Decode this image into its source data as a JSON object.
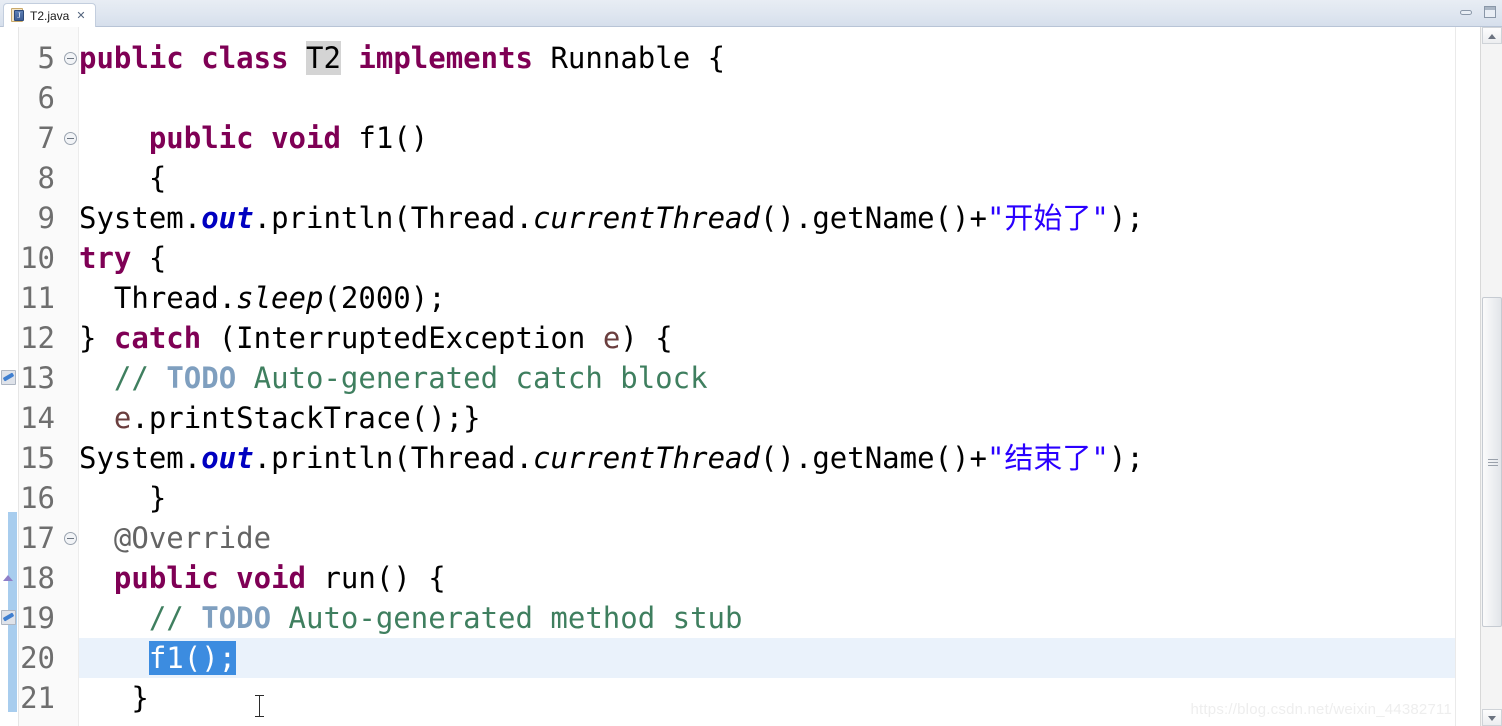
{
  "window": {
    "minimize_label": "Minimize",
    "maximize_label": "Maximize"
  },
  "tab": {
    "label": "T2.java",
    "icon": "java-file-icon",
    "icon_letter": "J",
    "close_glyph": "✕"
  },
  "editor": {
    "first_visible_line": 5,
    "current_line": 20,
    "selection_text": "f1();",
    "occurrence_highlight": "T2",
    "lines": [
      {
        "num": "5",
        "fold": true,
        "tokens": [
          {
            "t": "public",
            "c": "kw"
          },
          {
            "t": " ",
            "c": "plain"
          },
          {
            "t": "class",
            "c": "kw"
          },
          {
            "t": " ",
            "c": "plain"
          },
          {
            "t": "T2",
            "c": "occ"
          },
          {
            "t": " ",
            "c": "plain"
          },
          {
            "t": "implements",
            "c": "kw"
          },
          {
            "t": " Runnable {",
            "c": "plain"
          }
        ]
      },
      {
        "num": "6",
        "tokens": []
      },
      {
        "num": "7",
        "fold": true,
        "tokens": [
          {
            "t": "    ",
            "c": "plain"
          },
          {
            "t": "public",
            "c": "kw"
          },
          {
            "t": " ",
            "c": "plain"
          },
          {
            "t": "void",
            "c": "kw"
          },
          {
            "t": " f1()",
            "c": "plain"
          }
        ]
      },
      {
        "num": "8",
        "tokens": [
          {
            "t": "    {",
            "c": "plain"
          }
        ]
      },
      {
        "num": "9",
        "tokens": [
          {
            "t": "System.",
            "c": "plain"
          },
          {
            "t": "out",
            "c": "sfield"
          },
          {
            "t": ".println(Thread.",
            "c": "plain"
          },
          {
            "t": "currentThread",
            "c": "smeth"
          },
          {
            "t": "().getName()+",
            "c": "plain"
          },
          {
            "t": "\"开始了\"",
            "c": "str"
          },
          {
            "t": ");",
            "c": "plain"
          }
        ]
      },
      {
        "num": "10",
        "tokens": [
          {
            "t": "try",
            "c": "kw"
          },
          {
            "t": " {",
            "c": "plain"
          }
        ]
      },
      {
        "num": "11",
        "tokens": [
          {
            "t": "  Thread.",
            "c": "plain"
          },
          {
            "t": "sleep",
            "c": "smeth"
          },
          {
            "t": "(2000);",
            "c": "plain"
          }
        ]
      },
      {
        "num": "12",
        "tokens": [
          {
            "t": "} ",
            "c": "plain"
          },
          {
            "t": "catch",
            "c": "kw"
          },
          {
            "t": " (InterruptedException ",
            "c": "plain"
          },
          {
            "t": "e",
            "c": "param"
          },
          {
            "t": ") {",
            "c": "plain"
          }
        ]
      },
      {
        "num": "13",
        "marker": "task",
        "tokens": [
          {
            "t": "  // ",
            "c": "cmt"
          },
          {
            "t": "TODO",
            "c": "todo"
          },
          {
            "t": " Auto-generated catch block",
            "c": "cmt"
          }
        ]
      },
      {
        "num": "14",
        "tokens": [
          {
            "t": "  ",
            "c": "plain"
          },
          {
            "t": "e",
            "c": "param"
          },
          {
            "t": ".printStackTrace();}",
            "c": "plain"
          }
        ]
      },
      {
        "num": "15",
        "tokens": [
          {
            "t": "System.",
            "c": "plain"
          },
          {
            "t": "out",
            "c": "sfield"
          },
          {
            "t": ".println(Thread.",
            "c": "plain"
          },
          {
            "t": "currentThread",
            "c": "smeth"
          },
          {
            "t": "().getName()+",
            "c": "plain"
          },
          {
            "t": "\"结束了\"",
            "c": "str"
          },
          {
            "t": ");",
            "c": "plain"
          }
        ]
      },
      {
        "num": "16",
        "tokens": [
          {
            "t": "    }",
            "c": "plain"
          }
        ]
      },
      {
        "num": "17",
        "fold": true,
        "changed": true,
        "tokens": [
          {
            "t": "  @Override",
            "c": "annot"
          }
        ]
      },
      {
        "num": "18",
        "changed": true,
        "marker": "override",
        "tokens": [
          {
            "t": "  ",
            "c": "plain"
          },
          {
            "t": "public",
            "c": "kw"
          },
          {
            "t": " ",
            "c": "plain"
          },
          {
            "t": "void",
            "c": "kw"
          },
          {
            "t": " run() {",
            "c": "plain"
          }
        ]
      },
      {
        "num": "19",
        "changed": true,
        "marker": "task",
        "tokens": [
          {
            "t": "    // ",
            "c": "cmt"
          },
          {
            "t": "TODO",
            "c": "todo"
          },
          {
            "t": " Auto-generated method stub",
            "c": "cmt"
          }
        ]
      },
      {
        "num": "20",
        "changed": true,
        "current": true,
        "tokens": [
          {
            "t": "    ",
            "c": "plain"
          },
          {
            "t": "|",
            "c": "caret"
          },
          {
            "t": "f1();",
            "c": "sel"
          }
        ]
      },
      {
        "num": "21",
        "changed": true,
        "tokens": [
          {
            "t": "   }",
            "c": "plain"
          }
        ]
      }
    ]
  },
  "scrollbar": {
    "up_arrow": "scroll-up",
    "down_arrow": "scroll-down",
    "thumb": "scroll-thumb"
  },
  "watermark": {
    "text": "https://blog.csdn.net/weixin_44382711"
  },
  "colors": {
    "keyword": "#7f0055",
    "comment": "#3f7f5f",
    "todo": "#7f9fbf",
    "string": "#2a00ff",
    "static_field": "#0000c0",
    "annotation": "#646464",
    "parameter": "#6a3e3e",
    "selection": "#3c8ce0",
    "current_line": "#eaf2fb",
    "change_bar": "#a8cdee",
    "occurrence": "#d4d4d4"
  }
}
